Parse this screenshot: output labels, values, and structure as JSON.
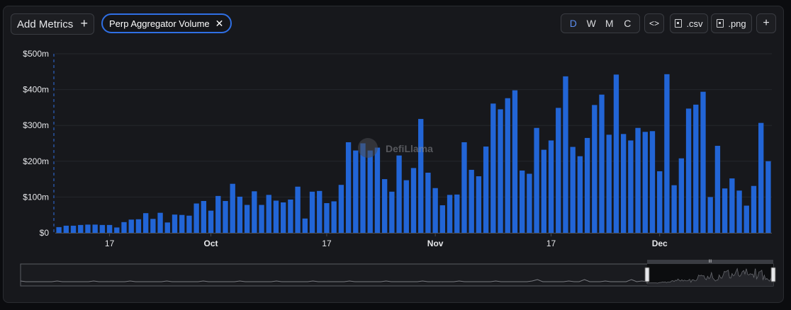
{
  "toolbar": {
    "add_metrics_label": "Add Metrics",
    "add_metrics_icon": "+",
    "metric_chip_label": "Perp Aggregator Volume",
    "metric_chip_close": "✕",
    "periods": [
      "D",
      "W",
      "M",
      "C"
    ],
    "active_period": "D",
    "embed_label": "<>",
    "csv_label": ".csv",
    "png_label": ".png",
    "more_label": "+"
  },
  "watermark": "DefiLlama",
  "colors": {
    "bar": "#2265d6",
    "accent": "#2f6fe4",
    "background": "#17181c"
  },
  "chart_data": {
    "type": "bar",
    "title": "",
    "xlabel": "",
    "ylabel": "",
    "ylim": [
      0,
      500
    ],
    "y_ticks": [
      "$0",
      "$100m",
      "$200m",
      "$300m",
      "$400m",
      "$500m"
    ],
    "y_tick_values": [
      0,
      100,
      200,
      300,
      400,
      500
    ],
    "x_tick_labels": [
      "17",
      "Oct",
      "17",
      "Nov",
      "17",
      "Dec"
    ],
    "x_tick_bar_index": [
      7,
      21,
      37,
      52,
      68,
      83
    ],
    "x_tick_bold": [
      false,
      true,
      false,
      true,
      false,
      true
    ],
    "series": [
      {
        "name": "Perp Aggregator Volume",
        "values": [
          16,
          20,
          20,
          22,
          23,
          23,
          22,
          22,
          15,
          30,
          37,
          38,
          55,
          39,
          56,
          29,
          51,
          50,
          48,
          82,
          89,
          62,
          103,
          89,
          137,
          101,
          78,
          116,
          78,
          106,
          90,
          85,
          93,
          129,
          40,
          115,
          117,
          83,
          88,
          134,
          253,
          230,
          250,
          230,
          238,
          150,
          115,
          216,
          147,
          181,
          318,
          168,
          125,
          77,
          106,
          107,
          253,
          176,
          158,
          241,
          361,
          345,
          376,
          398,
          174,
          165,
          293,
          232,
          258,
          349,
          437,
          240,
          214,
          265,
          357,
          386,
          274,
          442,
          276,
          258,
          293,
          282,
          284,
          172,
          443,
          133,
          208,
          347,
          358,
          394,
          100,
          243,
          124,
          152,
          118,
          76,
          131,
          307,
          200
        ]
      }
    ]
  },
  "navigator": {
    "grip_label": "III"
  }
}
